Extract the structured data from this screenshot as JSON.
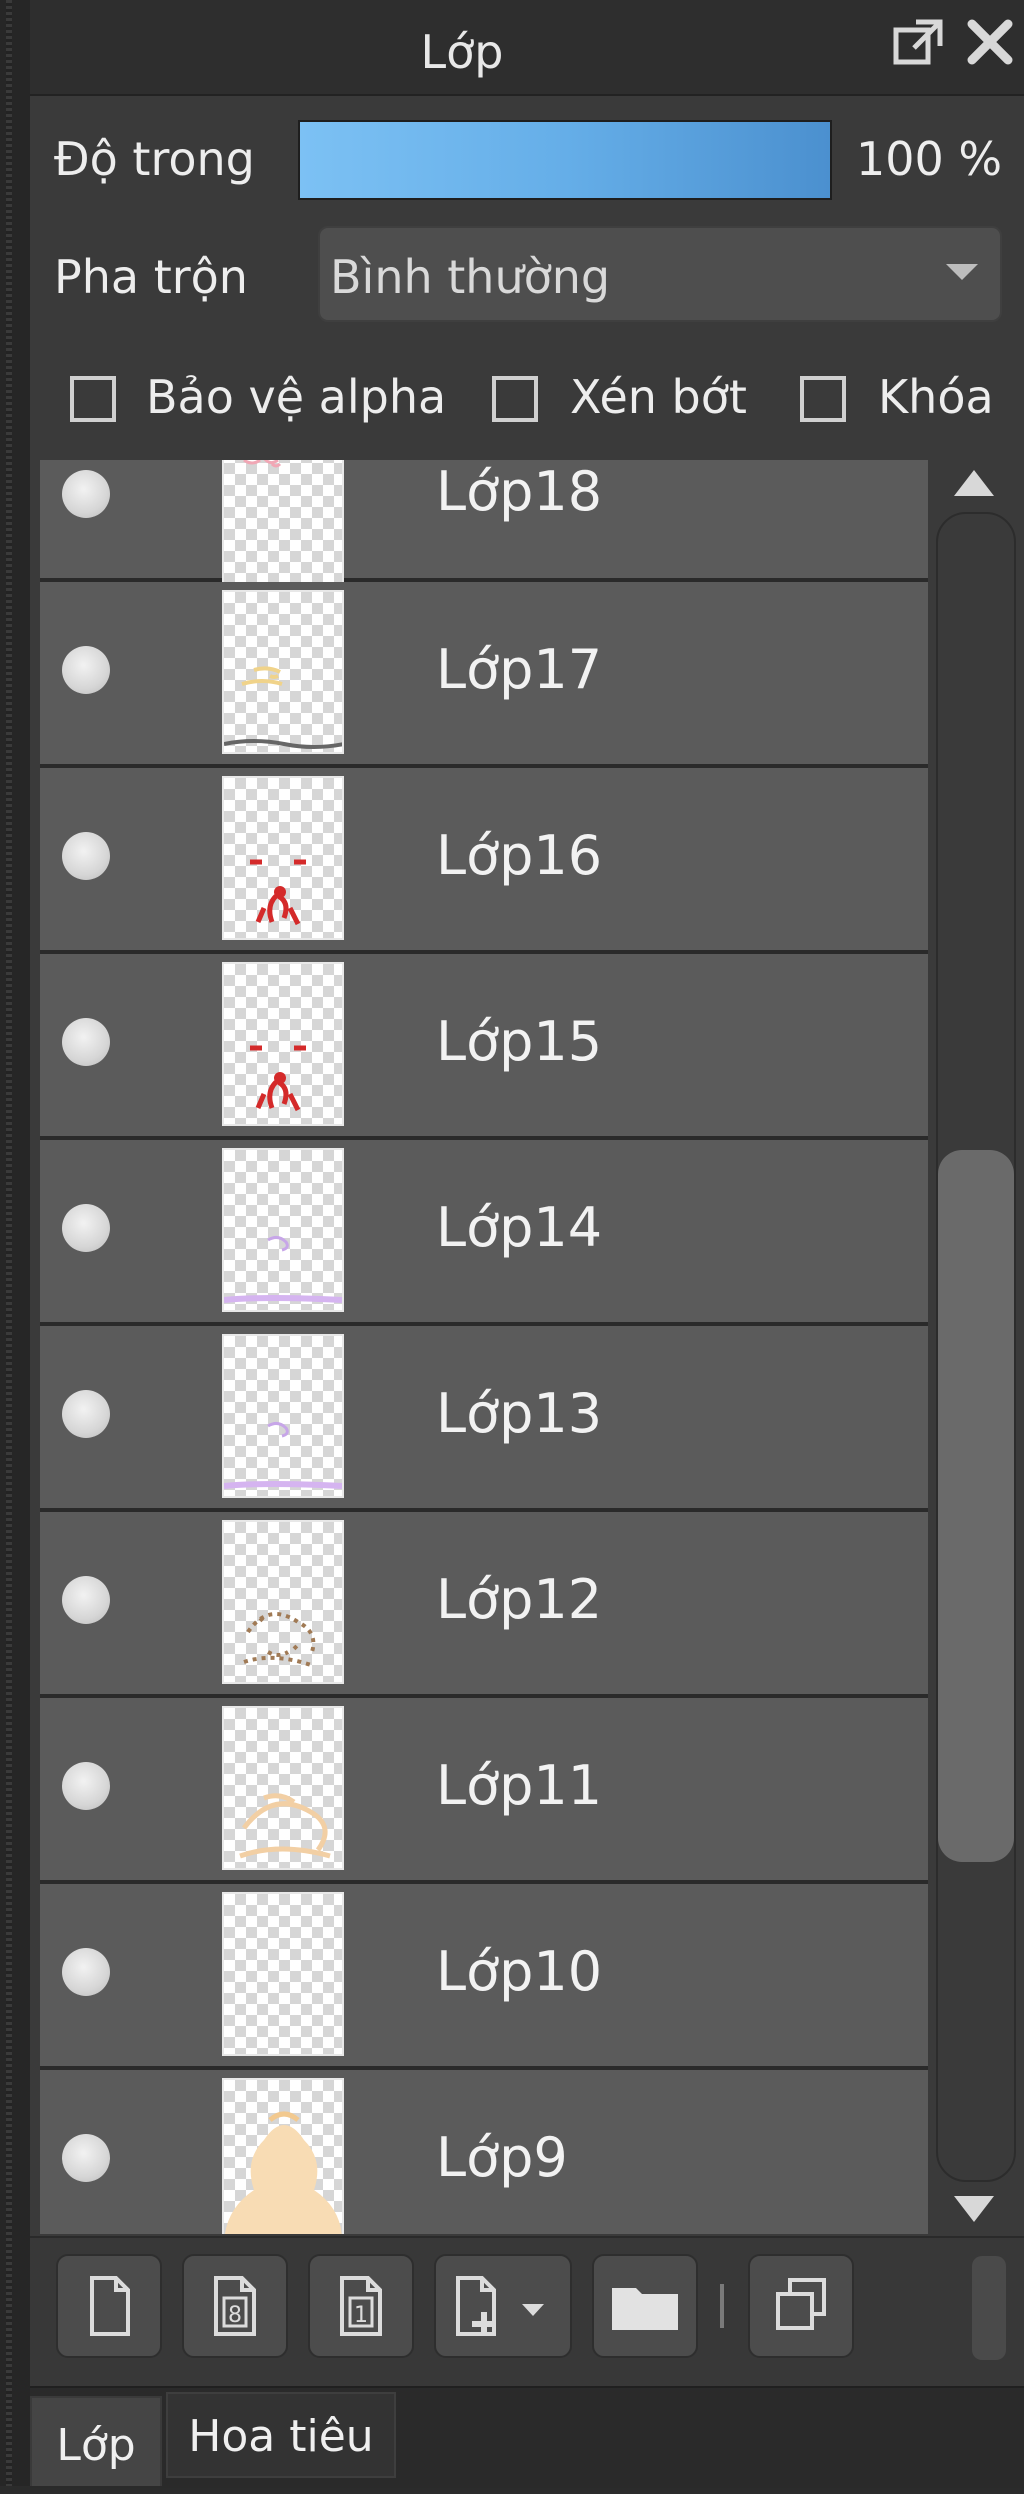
{
  "panel": {
    "title": "Lớp"
  },
  "opacity": {
    "label": "Độ trong",
    "value": "100 %",
    "percent": 100,
    "gradient": [
      "#7cc1f4",
      "#4b90cf"
    ]
  },
  "blend": {
    "label": "Pha trộn",
    "value": "Bình thường"
  },
  "options": {
    "protect_alpha": {
      "label": "Bảo vệ alpha",
      "checked": false
    },
    "clipping": {
      "label": "Xén bớt",
      "checked": false
    },
    "lock": {
      "label": "Khóa",
      "checked": false
    }
  },
  "layers": [
    {
      "name": "Lớp18",
      "visible": true,
      "thumb": "pink-sketch"
    },
    {
      "name": "Lớp17",
      "visible": true,
      "thumb": "yellow-sketch"
    },
    {
      "name": "Lớp16",
      "visible": true,
      "thumb": "red-sketch"
    },
    {
      "name": "Lớp15",
      "visible": true,
      "thumb": "red-sketch"
    },
    {
      "name": "Lớp14",
      "visible": true,
      "thumb": "purple-sketch"
    },
    {
      "name": "Lớp13",
      "visible": true,
      "thumb": "purple-sketch"
    },
    {
      "name": "Lớp12",
      "visible": true,
      "thumb": "brown-sketch"
    },
    {
      "name": "Lớp11",
      "visible": true,
      "thumb": "peach-sketch"
    },
    {
      "name": "Lớp10",
      "visible": true,
      "thumb": "empty"
    },
    {
      "name": "Lớp9",
      "visible": true,
      "thumb": "peach-fill"
    }
  ],
  "toolbar": {
    "buttons": [
      "new-layer-icon",
      "new-8bit-layer-icon",
      "new-1bit-layer-icon",
      "add-layer-menu-icon",
      "new-folder-icon",
      "duplicate-layer-icon"
    ]
  },
  "tabs": [
    {
      "label": "Lớp",
      "active": true
    },
    {
      "label": "Hoa tiêu",
      "active": false
    }
  ],
  "colors": {
    "row_bg": "#5b5b5b",
    "panel_bg": "#3a3a3a"
  }
}
